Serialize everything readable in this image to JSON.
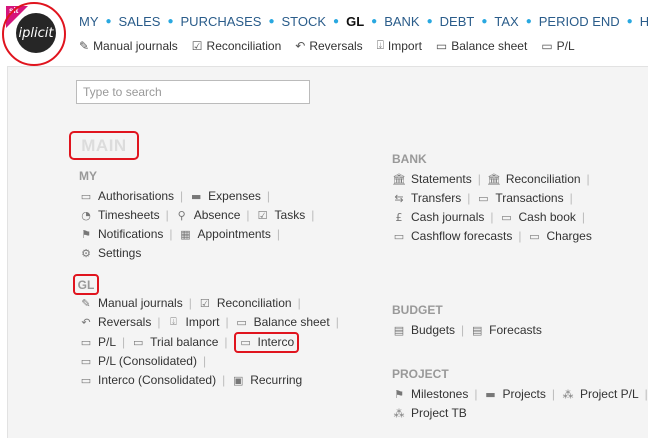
{
  "logo": {
    "text": "iplicit",
    "badge": "sit"
  },
  "topnav": [
    "MY",
    "SALES",
    "PURCHASES",
    "STOCK",
    "GL",
    "BANK",
    "DEBT",
    "TAX",
    "PERIOD END",
    "HR"
  ],
  "topnav_active": "GL",
  "subnav": [
    {
      "label": "Manual journals",
      "icon": "journal-icon"
    },
    {
      "label": "Reconciliation",
      "icon": "check-box-icon"
    },
    {
      "label": "Reversals",
      "icon": "arrow-back-icon"
    },
    {
      "label": "Import",
      "icon": "import-icon"
    },
    {
      "label": "Balance sheet",
      "icon": "book-icon"
    },
    {
      "label": "P/L",
      "icon": "book-icon"
    }
  ],
  "search": {
    "placeholder": "Type to search"
  },
  "main_title": "MAIN",
  "sections": {
    "my": {
      "title": "MY",
      "rows": [
        [
          {
            "label": "Authorisations",
            "icon": "chat-icon"
          },
          {
            "label": "Expenses",
            "icon": "card-icon"
          }
        ],
        [
          {
            "label": "Timesheets",
            "icon": "person-clock-icon"
          },
          {
            "label": "Absence",
            "icon": "person-icon"
          },
          {
            "label": "Tasks",
            "icon": "task-check-icon"
          }
        ],
        [
          {
            "label": "Notifications",
            "icon": "flag-icon"
          },
          {
            "label": "Appointments",
            "icon": "calendar-icon"
          }
        ],
        [
          {
            "label": "Settings",
            "icon": "gear-icon"
          }
        ]
      ]
    },
    "gl": {
      "title": "GL",
      "rows": [
        [
          {
            "label": "Manual journals",
            "icon": "journal-icon"
          },
          {
            "label": "Reconciliation",
            "icon": "check-box-icon"
          }
        ],
        [
          {
            "label": "Reversals",
            "icon": "arrow-back-icon"
          },
          {
            "label": "Import",
            "icon": "import-icon"
          },
          {
            "label": "Balance sheet",
            "icon": "book-icon"
          }
        ],
        [
          {
            "label": "P/L",
            "icon": "book-icon"
          },
          {
            "label": "Trial balance",
            "icon": "book-icon"
          },
          {
            "label": "Interco",
            "icon": "book-icon"
          }
        ],
        [
          {
            "label": "P/L (Consolidated)",
            "icon": "book-icon"
          }
        ],
        [
          {
            "label": "Interco (Consolidated)",
            "icon": "book-icon"
          },
          {
            "label": "Recurring",
            "icon": "recurring-icon"
          }
        ]
      ]
    },
    "bank": {
      "title": "BANK",
      "rows": [
        [
          {
            "label": "Statements",
            "icon": "bank-icon"
          },
          {
            "label": "Reconciliation",
            "icon": "bank-check-icon"
          }
        ],
        [
          {
            "label": "Transfers",
            "icon": "transfer-icon"
          },
          {
            "label": "Transactions",
            "icon": "book-icon"
          }
        ],
        [
          {
            "label": "Cash journals",
            "icon": "pound-icon"
          },
          {
            "label": "Cash book",
            "icon": "book-icon"
          }
        ],
        [
          {
            "label": "Cashflow forecasts",
            "icon": "book-icon"
          },
          {
            "label": "Charges",
            "icon": "book-icon"
          }
        ]
      ]
    },
    "budget": {
      "title": "BUDGET",
      "rows": [
        [
          {
            "label": "Budgets",
            "icon": "document-icon"
          },
          {
            "label": "Forecasts",
            "icon": "document-icon"
          }
        ]
      ]
    },
    "project": {
      "title": "PROJECT",
      "rows": [
        [
          {
            "label": "Milestones",
            "icon": "flag-icon"
          },
          {
            "label": "Projects",
            "icon": "folder-icon"
          },
          {
            "label": "Project P/L",
            "icon": "hierarchy-icon"
          }
        ],
        [
          {
            "label": "Project TB",
            "icon": "hierarchy-icon"
          }
        ]
      ]
    }
  }
}
